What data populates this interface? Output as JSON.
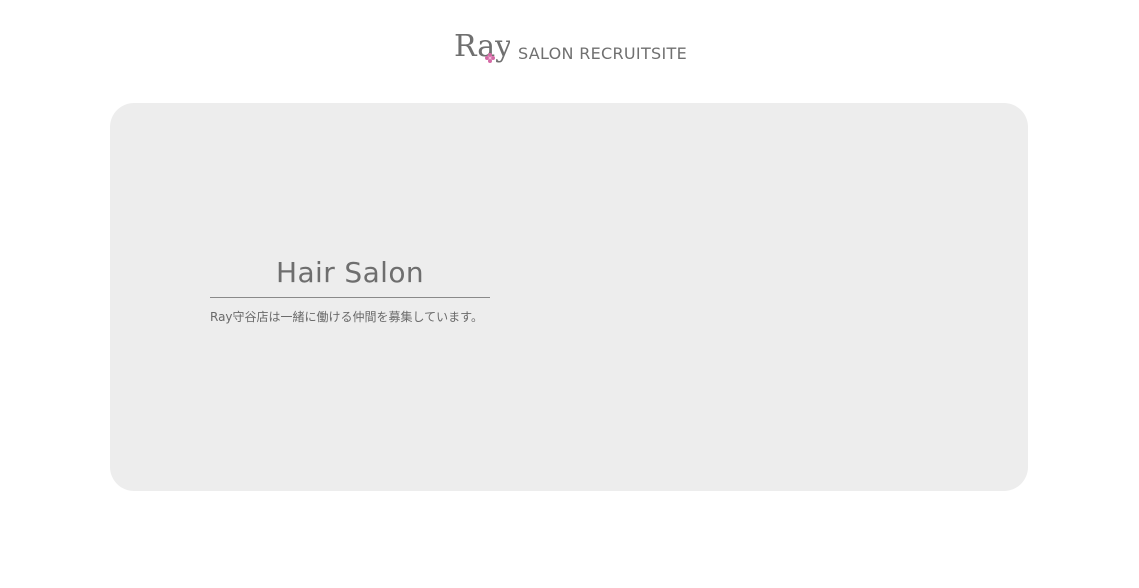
{
  "header": {
    "logo_text": "Ray",
    "logo_icon": "flower-icon",
    "subtitle": "SALON RECRUITSITE"
  },
  "hero": {
    "title": "Hair Salon",
    "description": "Ray守谷店は一緒に働ける仲間を募集しています。"
  },
  "colors": {
    "panel_bg": "#ededed",
    "text": "#707070",
    "accent_flower": "#d46aa6"
  }
}
